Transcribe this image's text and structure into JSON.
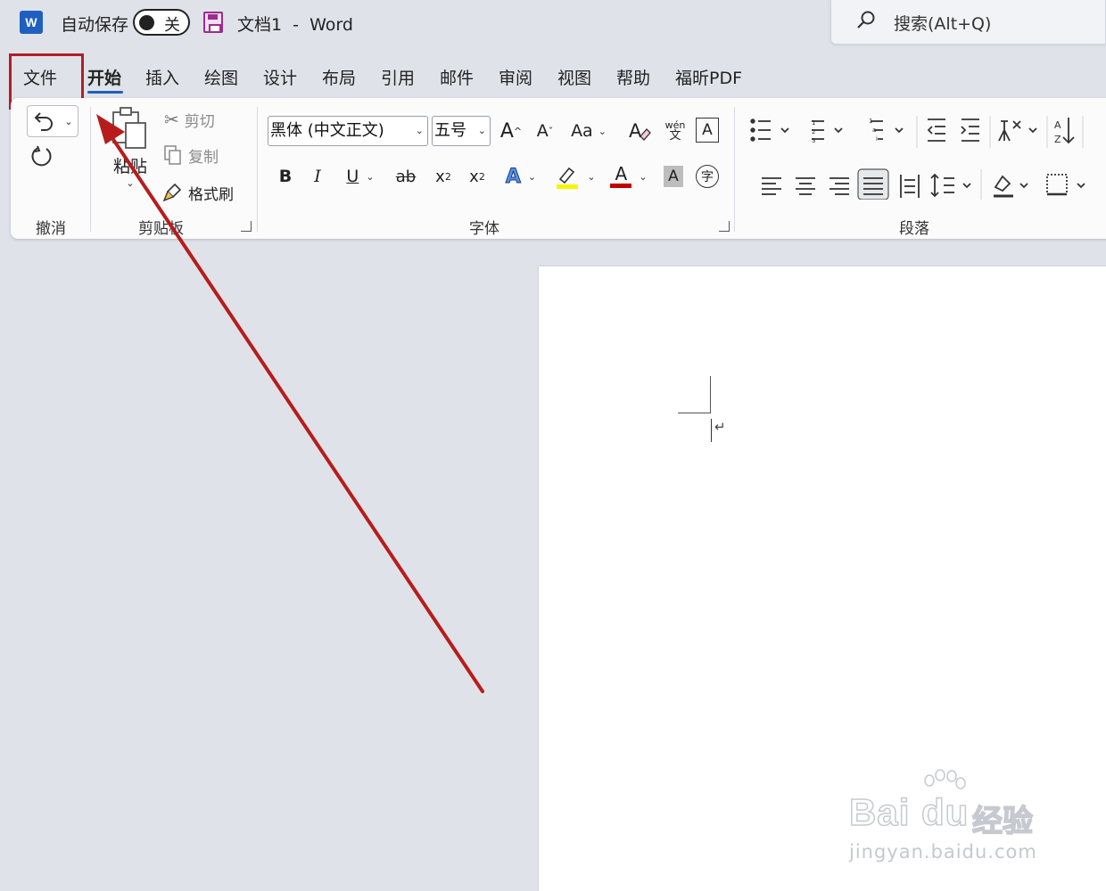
{
  "titlebar": {
    "app_icon": "word-icon",
    "app_icon_letter": "W",
    "autosave_label": "自动保存",
    "autosave_state": "关",
    "doc_title": "文档1  -  Word",
    "search_placeholder": "搜索(Alt+Q)"
  },
  "tabs": [
    "文件",
    "开始",
    "插入",
    "绘图",
    "设计",
    "布局",
    "引用",
    "邮件",
    "审阅",
    "视图",
    "帮助",
    "福昕PDF"
  ],
  "active_tab": "开始",
  "highlighted_tab": "文件",
  "ribbon": {
    "undo": {
      "label": "撤消",
      "undo_icon": "undo-icon",
      "redo_icon": "redo-icon"
    },
    "clipboard": {
      "label": "剪贴板",
      "paste": "粘贴",
      "cut": "剪切",
      "copy": "复制",
      "format_painter": "格式刷"
    },
    "font": {
      "label": "字体",
      "font_name": "黑体 (中文正文)",
      "font_size": "五号",
      "grow": "A",
      "shrink": "A",
      "case": "Aa",
      "phonetic_top": "wén",
      "phonetic_bottom": "文",
      "bold": "B",
      "italic": "I",
      "underline": "U",
      "strike": "ab",
      "subscript": "x",
      "superscript": "x",
      "text_effect": "A",
      "font_color": "A",
      "char_shading": "A",
      "enclose": "字"
    },
    "paragraph": {
      "label": "段落"
    }
  },
  "colors": {
    "accent": "#1f5fbf",
    "highlight_box": "#b11e28",
    "arrow": "#b71c1c",
    "highlight_yellow": "#f5f500",
    "font_color_bar": "#c00000"
  },
  "watermark": {
    "logo": "Bai du",
    "cn": "经验",
    "url": "jingyan.baidu.com"
  }
}
